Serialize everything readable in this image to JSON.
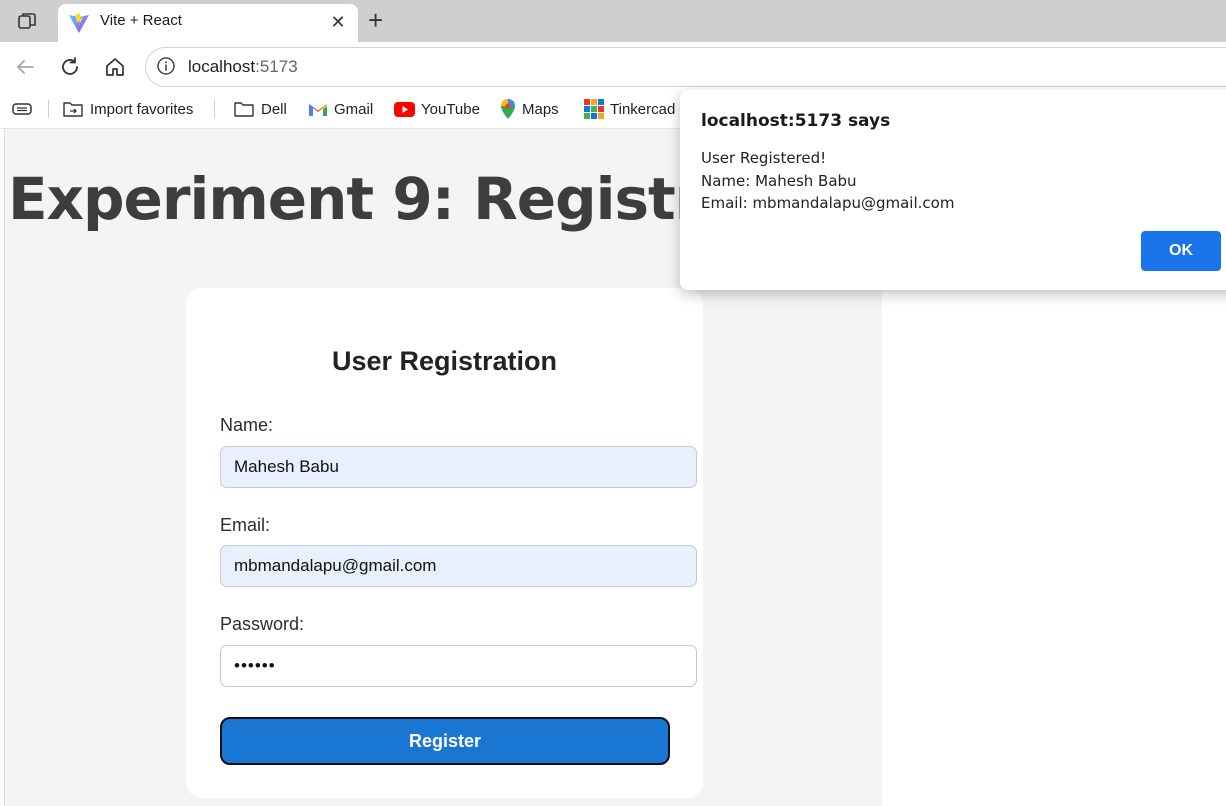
{
  "browser": {
    "tab": {
      "title": "Vite + React",
      "close": "✕"
    },
    "new_tab": "+",
    "address": {
      "host": "localhost",
      "port": ":5173"
    },
    "bookmarks": [
      "Import favorites",
      "Dell",
      "Gmail",
      "YouTube",
      "Maps",
      "Tinkercad"
    ]
  },
  "page": {
    "heading": "Experiment 9: Registration",
    "form": {
      "title": "User Registration",
      "name_label": "Name:",
      "name_value": "Mahesh Babu",
      "email_label": "Email:",
      "email_value": "mbmandalapu@gmail.com",
      "password_label": "Password:",
      "password_value": "••••••",
      "submit_label": "Register"
    }
  },
  "alert": {
    "title": "localhost:5173 says",
    "line1": "User Registered!",
    "line2": "Name: Mahesh Babu",
    "line3": "Email: mbmandalapu@gmail.com",
    "ok_label": "OK"
  },
  "colors": {
    "tabbar": "#cfcfcf",
    "page_bg": "#f4f4f4",
    "register_button": "#1976d2",
    "ok_button": "#1a73e8",
    "autofill": "#e8f0fe"
  }
}
